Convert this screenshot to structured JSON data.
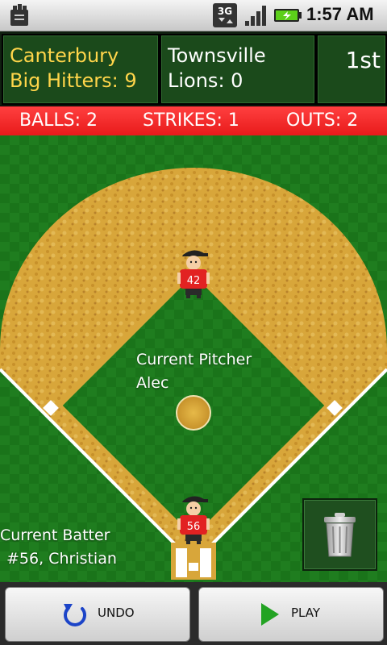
{
  "statusbar": {
    "time": "1:57 AM",
    "network_label": "3G",
    "icons": [
      "sd-card-icon",
      "3g-data-icon",
      "signal-strength-icon",
      "battery-charging-icon"
    ]
  },
  "scoreboard": {
    "home_team_line1": "Canterbury",
    "home_team_line2": "Big Hitters: 9",
    "away_team_line1": "Townsville",
    "away_team_line2": "Lions: 0",
    "inning": "1st"
  },
  "count": {
    "balls": "BALLS: 2",
    "strikes": "STRIKES: 1",
    "outs": "OUTS: 2"
  },
  "field": {
    "pitcher_label": "Current Pitcher",
    "pitcher_name": "Alec",
    "pitcher_number": "42",
    "batter_label": "Current Batter",
    "batter_name": "#56, Christian",
    "batter_number": "56"
  },
  "buttons": {
    "undo": "UNDO",
    "play": "PLAY"
  },
  "colors": {
    "grass": "#1d7a1d",
    "infield_dirt": "#d9a73a",
    "count_bar": "#f12a2a",
    "home_team_text": "#ffd54a",
    "play_icon": "#23a323",
    "undo_icon": "#1c44c8"
  }
}
